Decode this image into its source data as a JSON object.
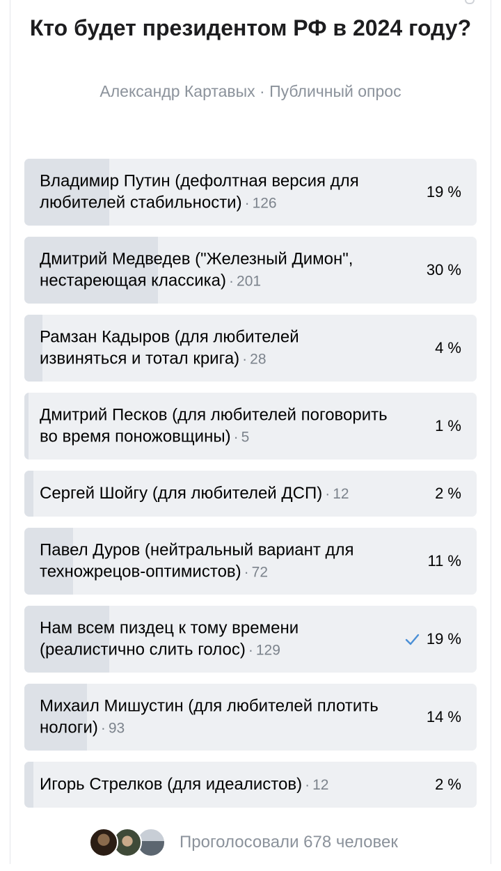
{
  "poll": {
    "title": "Кто будет президентом РФ в 2024 году?",
    "meta": "Александр Картавых · Публичный опрос",
    "options": [
      {
        "label": "Владимир Путин (дефолтная версия для любителей стабильности)",
        "count": "126",
        "percent": "19 %",
        "share": 0.19,
        "voted": false
      },
      {
        "label": "Дмитрий Медведев (\"Железный Димон\", нестареющая классика)",
        "count": "201",
        "percent": "30 %",
        "share": 0.3,
        "voted": false
      },
      {
        "label": "Рамзан Кадыров (для любителей извиняться и тотал крига)",
        "count": "28",
        "percent": "4 %",
        "share": 0.04,
        "voted": false
      },
      {
        "label": "Дмитрий Песков (для любителей поговорить во время поножовщины)",
        "count": "5",
        "percent": "1 %",
        "share": 0.01,
        "voted": false
      },
      {
        "label": "Сергей Шойгу (для любителей ДСП)",
        "count": "12",
        "percent": "2 %",
        "share": 0.02,
        "voted": false
      },
      {
        "label": "Павел Дуров (нейтральный вариант для техножрецов-оптимистов)",
        "count": "72",
        "percent": "11 %",
        "share": 0.11,
        "voted": false
      },
      {
        "label": "Нам всем пиздец к тому времени (реалистично слить голос)",
        "count": "129",
        "percent": "19 %",
        "share": 0.19,
        "voted": true
      },
      {
        "label": "Михаил Мишустин (для любителей плотить нологи)",
        "count": "93",
        "percent": "14 %",
        "share": 0.14,
        "voted": false
      },
      {
        "label": "Игорь Стрелков (для идеалистов)",
        "count": "12",
        "percent": "2 %",
        "share": 0.02,
        "voted": false
      }
    ],
    "footer": "Проголосовали 678 человек"
  },
  "colors": {
    "accent": "#4a8fd6",
    "fill": "#dde1e7",
    "track": "#eef0f3",
    "muted": "#8b929b"
  }
}
